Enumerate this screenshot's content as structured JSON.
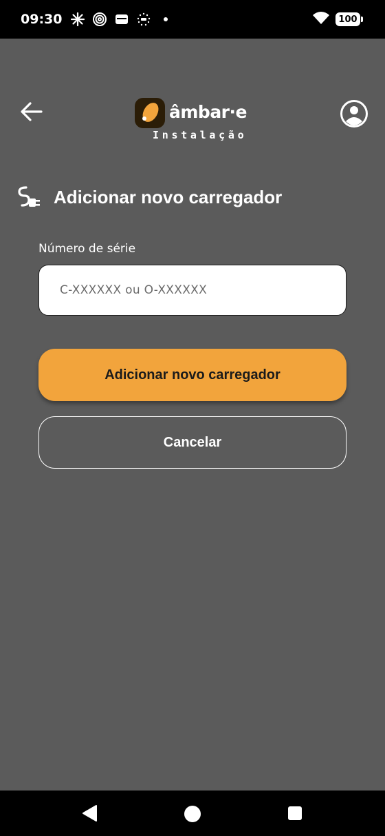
{
  "status_bar": {
    "time": "09:30",
    "icons": [
      "sparkle-icon",
      "spiral-icon",
      "wallet-icon",
      "euro-dots-icon",
      "notification-dot-icon"
    ],
    "battery": "100"
  },
  "header": {
    "brand": "âmbar·e",
    "subtitle": "Instalação"
  },
  "page": {
    "title": "Adicionar novo carregador"
  },
  "form": {
    "serial_label": "Número de série",
    "serial_placeholder": "C-XXXXXX ou O-XXXXXX",
    "serial_value": "",
    "submit_label": "Adicionar novo carregador",
    "cancel_label": "Cancelar"
  },
  "colors": {
    "background": "#5b5b5b",
    "accent": "#f2a43c",
    "logo_badge": "#2b1d07"
  }
}
